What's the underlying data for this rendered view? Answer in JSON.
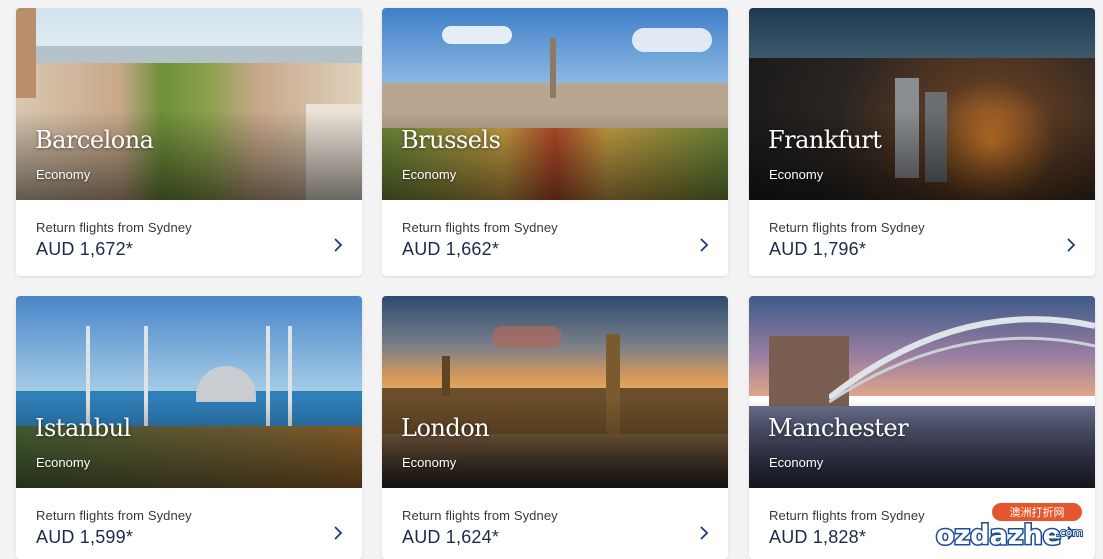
{
  "colors": {
    "page_bg": "#f3f3f3",
    "price_text": "#1b2a4a",
    "arrow": "#1b3a7a"
  },
  "destinations": [
    {
      "city": "Barcelona",
      "cabin": "Economy",
      "from_label": "Return flights from Sydney",
      "price": "AUD 1,672*"
    },
    {
      "city": "Brussels",
      "cabin": "Economy",
      "from_label": "Return flights from Sydney",
      "price": "AUD 1,662*"
    },
    {
      "city": "Frankfurt",
      "cabin": "Economy",
      "from_label": "Return flights from Sydney",
      "price": "AUD 1,796*"
    },
    {
      "city": "Istanbul",
      "cabin": "Economy",
      "from_label": "Return flights from Sydney",
      "price": "AUD 1,599*"
    },
    {
      "city": "London",
      "cabin": "Economy",
      "from_label": "Return flights from Sydney",
      "price": "AUD 1,624*"
    },
    {
      "city": "Manchester",
      "cabin": "Economy",
      "from_label": "Return flights from Sydney",
      "price": "AUD 1,828*"
    }
  ],
  "watermark": {
    "brand": "ozdazhe",
    "suffix": ".com",
    "cn_label": "澳洲打折网"
  },
  "icons": {
    "card_arrow": "chevron-right-icon"
  }
}
